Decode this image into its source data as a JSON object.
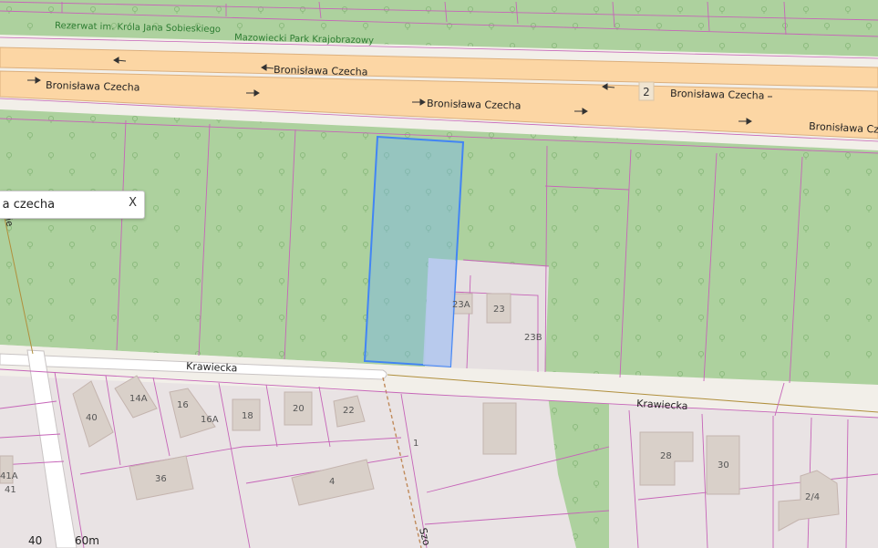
{
  "map": {
    "labels": {
      "reserve": "Rezerwat im. Króla Jana Sobieskiego",
      "park": "Mazowiecki Park Krajobrazowy",
      "street_czecha": "Bronisława Czecha",
      "street_krawiecka": "Krawiecka",
      "street_szo": "Szo",
      "route_ref": "2",
      "street_left": "ie"
    },
    "house_numbers": [
      "23A",
      "23",
      "23B",
      "14A",
      "16",
      "16A",
      "18",
      "20",
      "22",
      "40",
      "36",
      "4",
      "1",
      "28",
      "30",
      "2/4",
      "41A",
      "41"
    ],
    "colors": {
      "forest": "#add19e",
      "residential": "#e0dfdf",
      "road_primary": "#fcd6a4",
      "boundary": "#c665b8",
      "selection_stroke": "#4285f4",
      "selection_fill": "#7ab6e6"
    }
  },
  "search": {
    "value": "wa czecha",
    "clear_label": "X"
  },
  "scale": {
    "label_left": "40",
    "label_right": "60m"
  }
}
